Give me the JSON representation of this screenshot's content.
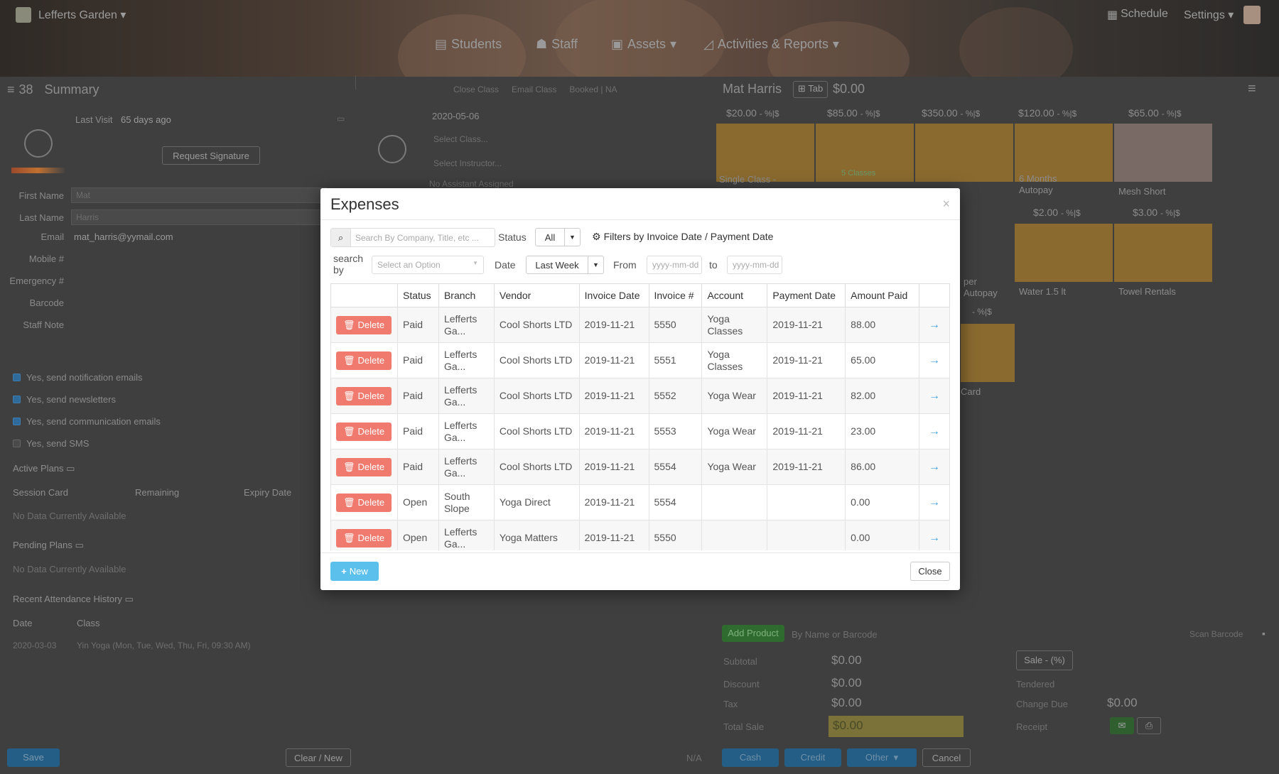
{
  "header": {
    "org_name": "Lefferts Garden",
    "schedule_label": "Schedule",
    "settings_label": "Settings",
    "nav": [
      "Students",
      "Staff",
      "Assets",
      "Activities & Reports"
    ]
  },
  "left_panel": {
    "count": "38",
    "title": "Summary",
    "last_visit_label": "Last Visit",
    "last_visit_value": "65 days ago",
    "request_signature": "Request Signature",
    "fields": [
      {
        "label": "First Name",
        "value": "Mat"
      },
      {
        "label": "Last Name",
        "value": "Harris"
      },
      {
        "label": "Email",
        "value": "mat_harris@yymail.com"
      },
      {
        "label": "Mobile #",
        "value": ""
      },
      {
        "label": "Emergency #",
        "value": ""
      },
      {
        "label": "Barcode",
        "value": ""
      },
      {
        "label": "Staff Note",
        "value": ""
      }
    ],
    "checkboxes": [
      {
        "label": "Yes, send notification emails",
        "checked": true
      },
      {
        "label": "Yes, send newsletters",
        "checked": true
      },
      {
        "label": "Yes, send communication emails",
        "checked": true
      },
      {
        "label": "Yes, send SMS",
        "checked": false
      }
    ],
    "active_plans": "Active Plans",
    "plan_cols": [
      "Session Card",
      "Remaining",
      "Expiry Date"
    ],
    "no_data": "No Data Currently Available",
    "pending_plans": "Pending Plans",
    "recent_attendance": "Recent Attendance History",
    "attendance_cols": [
      "Date",
      "Class"
    ],
    "attendance_rows": [
      {
        "date": "2020-03-03",
        "class": "Yin Yoga (Mon, Tue, Wed, Thu, Fri, 09:30 AM)"
      }
    ],
    "save": "Save",
    "clear_new": "Clear / New"
  },
  "middle_panel": {
    "close_class": "Close Class",
    "email_class": "Email Class",
    "booked": "Booked | NA",
    "date": "2020-05-06",
    "select_class": "Select Class...",
    "select_instructor": "Select Instructor...",
    "no_assistant": "No Assistant Assigned",
    "na": "N/A"
  },
  "right_panel": {
    "customer": "Mat Harris",
    "tab_label": "Tab",
    "balance": "$0.00",
    "products_row1": [
      {
        "price": "$20.00",
        "name": "Single Class -"
      },
      {
        "price": "$85.00",
        "name": "5 Classes"
      },
      {
        "price": "$350.00",
        "name": "Card"
      },
      {
        "price": "$120.00",
        "name": "6 Months Autopay"
      },
      {
        "price": "$65.00",
        "name": "Mesh Short"
      }
    ],
    "products_row2": [
      {
        "price": "$2.00",
        "name": "Water 1.5 lt"
      },
      {
        "price": "$3.00",
        "name": "Towel Rentals"
      }
    ],
    "partial_labels": [
      "per",
      "Autopay",
      "Card"
    ],
    "discount_suffix": "- %|$",
    "add_product": "Add Product",
    "product_placeholder": "By Name or Barcode",
    "scan_barcode": "Scan Barcode",
    "subtotal_label": "Subtotal",
    "subtotal": "$0.00",
    "discount_label": "Discount",
    "discount": "$0.00",
    "tax_label": "Tax",
    "tax": "$0.00",
    "total_label": "Total Sale",
    "total": "$0.00",
    "sale_btn": "Sale - (%)",
    "tendered_label": "Tendered",
    "change_label": "Change Due",
    "change": "$0.00",
    "receipt_label": "Receipt",
    "cash": "Cash",
    "credit": "Credit",
    "other": "Other",
    "cancel": "Cancel"
  },
  "modal": {
    "title": "Expenses",
    "search_placeholder": "Search By Company, Title, etc ...",
    "status_label": "Status",
    "status_value": "All",
    "filters_text": "Filters by Invoice Date / Payment Date",
    "search_by_label": "search by",
    "select_option": "Select an Option",
    "date_label": "Date",
    "date_value": "Last Week",
    "from_label": "From",
    "to_label": "to",
    "date_placeholder": "yyyy-mm-dd",
    "columns": [
      "",
      "Status",
      "Branch",
      "Vendor",
      "Invoice Date",
      "Invoice #",
      "Account",
      "Payment Date",
      "Amount Paid",
      ""
    ],
    "delete_label": "Delete",
    "rows": [
      {
        "status": "Paid",
        "branch": "Lefferts Ga...",
        "vendor": "Cool Shorts LTD",
        "invoice_date": "2019-11-21",
        "invoice_no": "5550",
        "account": "Yoga Classes",
        "payment_date": "2019-11-21",
        "amount": "88.00"
      },
      {
        "status": "Paid",
        "branch": "Lefferts Ga...",
        "vendor": "Cool Shorts LTD",
        "invoice_date": "2019-11-21",
        "invoice_no": "5551",
        "account": "Yoga Classes",
        "payment_date": "2019-11-21",
        "amount": "65.00"
      },
      {
        "status": "Paid",
        "branch": "Lefferts Ga...",
        "vendor": "Cool Shorts LTD",
        "invoice_date": "2019-11-21",
        "invoice_no": "5552",
        "account": "Yoga Wear",
        "payment_date": "2019-11-21",
        "amount": "82.00"
      },
      {
        "status": "Paid",
        "branch": "Lefferts Ga...",
        "vendor": "Cool Shorts LTD",
        "invoice_date": "2019-11-21",
        "invoice_no": "5553",
        "account": "Yoga Wear",
        "payment_date": "2019-11-21",
        "amount": "23.00"
      },
      {
        "status": "Paid",
        "branch": "Lefferts Ga...",
        "vendor": "Cool Shorts LTD",
        "invoice_date": "2019-11-21",
        "invoice_no": "5554",
        "account": "Yoga Wear",
        "payment_date": "2019-11-21",
        "amount": "86.00"
      },
      {
        "status": "Open",
        "branch": "South Slope",
        "vendor": "Yoga Direct",
        "invoice_date": "2019-11-21",
        "invoice_no": "5554",
        "account": "",
        "payment_date": "",
        "amount": "0.00"
      },
      {
        "status": "Open",
        "branch": "Lefferts Ga...",
        "vendor": "Yoga Matters",
        "invoice_date": "2019-11-21",
        "invoice_no": "5550",
        "account": "",
        "payment_date": "",
        "amount": "0.00"
      }
    ],
    "new_label": "New",
    "close_label": "Close"
  },
  "colors": {
    "delete": "#f07a6e",
    "new": "#5bc0eb",
    "arrow": "#3aa1e6",
    "overlay": "#3f3f3f"
  }
}
